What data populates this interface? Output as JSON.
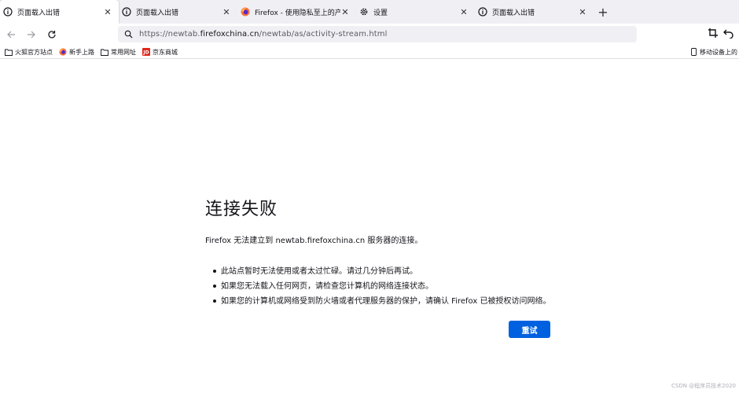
{
  "tabs": [
    {
      "icon": "info-icon",
      "label": "页面载入出错",
      "active": true
    },
    {
      "icon": "info-icon",
      "label": "页面载入出错",
      "active": false
    },
    {
      "icon": "firefox-icon",
      "label": "Firefox - 使用隐私至上的产品保护",
      "active": false
    },
    {
      "icon": "gear-icon",
      "label": "设置",
      "active": false
    },
    {
      "icon": "info-icon",
      "label": "页面载入出错",
      "active": false
    }
  ],
  "navbar": {
    "url_prefix": "https://newtab.",
    "url_domain": "firefoxchina.cn",
    "url_path": "/newtab/as/activity-stream.html"
  },
  "bookmarks": {
    "items": [
      {
        "icon": "folder-icon",
        "label": "火狐官方站点"
      },
      {
        "icon": "firefox-icon",
        "label": "新手上路"
      },
      {
        "icon": "folder-icon",
        "label": "常用网址"
      },
      {
        "icon": "jd-icon",
        "label": "京东商城"
      }
    ],
    "mobile_label": "移动设备上的"
  },
  "error": {
    "title": "连接失败",
    "description": "Firefox 无法建立到 newtab.firefoxchina.cn 服务器的连接。",
    "bullets": [
      "此站点暂时无法使用或者太过忙碌。请过几分钟后再试。",
      "如果您无法载入任何网页，请检查您计算机的网络连接状态。",
      "如果您的计算机或网络受到防火墙或者代理服务器的保护，请确认 Firefox 已被授权访问网络。"
    ],
    "retry_label": "重试"
  },
  "watermark": "CSDN @程序员技术2020",
  "colors": {
    "accent": "#0061e0",
    "tabstrip": "#f0f0f4"
  }
}
